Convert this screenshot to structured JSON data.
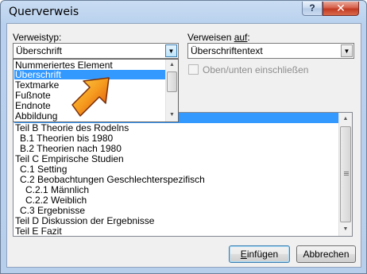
{
  "window": {
    "title": "Querverweis",
    "help_label": "?",
    "close_label": "✕"
  },
  "reference_type": {
    "label": "Verweistyp:",
    "value": "Überschrift"
  },
  "refer_to": {
    "label_prefix": "Verweisen ",
    "label_underlined": "auf",
    "label_suffix": ":",
    "value": "Überschriftentext"
  },
  "above_below": {
    "label": "Oben/unten einschließen",
    "checked": false,
    "enabled": false
  },
  "dropdown_options": [
    "Nummeriertes Element",
    "Überschrift",
    "Textmarke",
    "Fußnote",
    "Endnote",
    "Abbildung"
  ],
  "dropdown_selected_index": 1,
  "headings_list": [
    "Teil B Theorie des Rodelns",
    "B.1 Theorien bis 1980",
    "B.2 Theorien nach 1980",
    "Teil C Empirische Studien",
    "C.1 Setting",
    "C.2 Beobachtungen Geschlechterspezifisch",
    "C.2.1 Männlich",
    "C.2.2 Weiblich",
    "C.3 Ergebnisse",
    "Teil D Diskussion der Ergebnisse",
    "Teil E Fazit"
  ],
  "buttons": {
    "insert_underlined": "E",
    "insert_rest": "infügen",
    "cancel": "Abbrechen"
  },
  "colors": {
    "selection": "#3399ff",
    "pointer_arrow": "#f07a12"
  },
  "icons": {
    "pointer": "orange-pointer-arrow-icon",
    "dropdown_arrow": "chevron-down-icon"
  }
}
